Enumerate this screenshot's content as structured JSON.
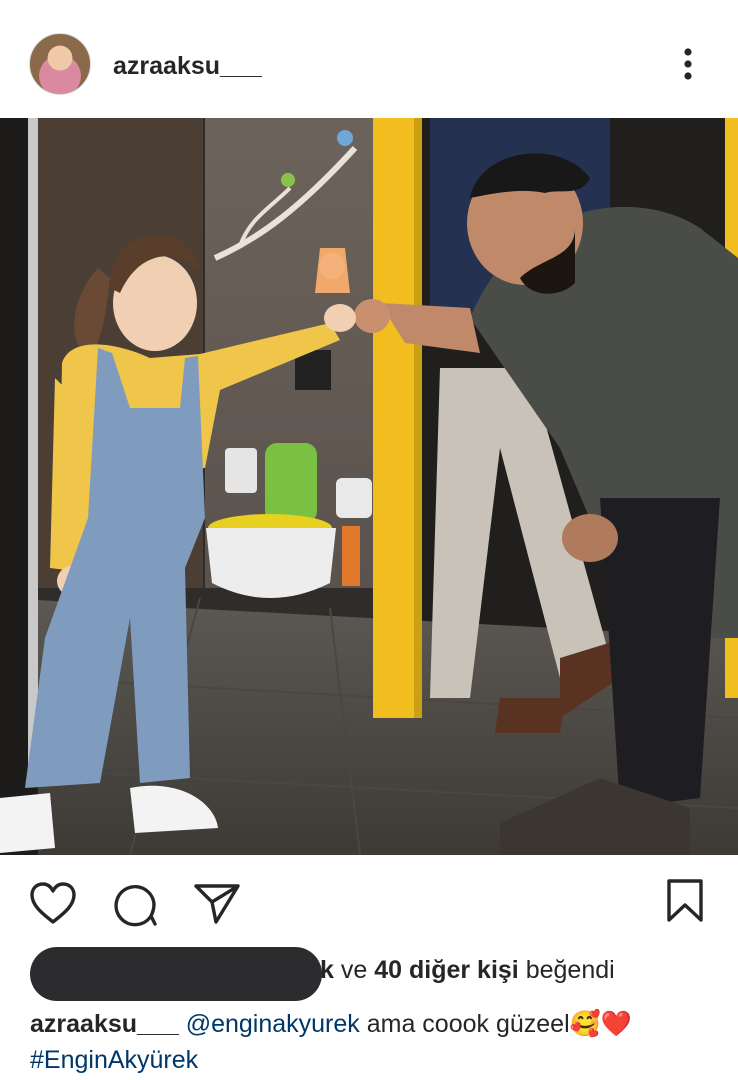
{
  "post": {
    "username": "azraaksu___",
    "likes": {
      "suffix_fragment": "k",
      "connector": "ve",
      "count_text": "40 diğer kişi",
      "verb": "beğendi"
    },
    "caption": {
      "username": "azraaksu___",
      "mention": "@enginakyurek",
      "text": " ama coook güzeel🥰❤️",
      "hashtag": "#EnginAkyürek"
    }
  },
  "icons": [
    "more-vertical-icon",
    "heart-icon",
    "comment-icon",
    "share-icon",
    "bookmark-icon"
  ],
  "colors": {
    "link": "#00376b",
    "text": "#262626",
    "accent_yellow": "#f2bd1e"
  }
}
